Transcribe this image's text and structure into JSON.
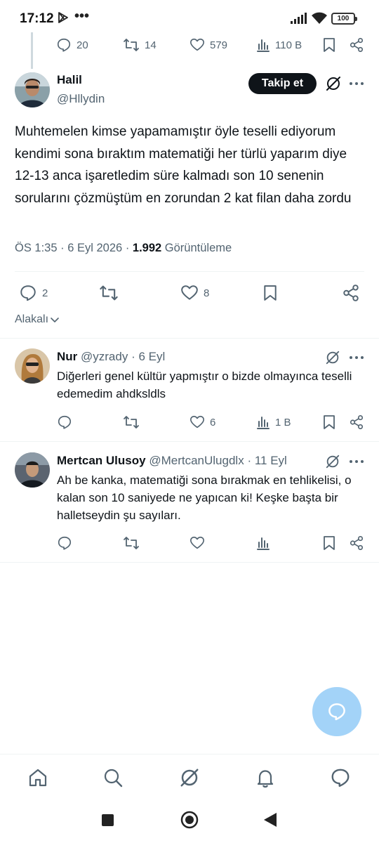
{
  "status_bar": {
    "time": "17:12",
    "dots": "•••",
    "battery": "100"
  },
  "parent_tweet_actions": {
    "replies": "20",
    "retweets": "14",
    "likes": "579",
    "views": "110 B"
  },
  "main_tweet": {
    "author_name": "Halil",
    "author_handle": "@Hllydin",
    "follow_label": "Takip et",
    "text": "Muhtemelen kimse yapamamıştır öyle teselli ediyorum kendimi sona bıraktım matematiği her türlü yaparım diye 12-13 anca işaretledim süre kalmadı son 10 senenin sorularını çözmüştüm en zorundan 2 kat filan daha zordu",
    "time": "ÖS 1:35",
    "sep1": "·",
    "date": "6 Eyl 2026",
    "sep2": "·",
    "views_count": "1.992",
    "views_label": "Görüntüleme",
    "replies": "2",
    "likes": "8"
  },
  "sort_label": "Alakalı",
  "replies": [
    {
      "name": "Nur",
      "handle": "@yzrady",
      "date": "· 6 Eyl",
      "text": "Diğerleri genel kültür yapmıştır o bizde olmayınca teselli edemedim ahdksldls",
      "likes": "6",
      "views": "1 B"
    },
    {
      "name": "Mertcan Ulusoy",
      "handle": "@MertcanUlugdlx",
      "date": "· 11 Eyl",
      "text": "Ah be kanka, matematiği sona bırakmak en tehlikelisi, o kalan son 10 saniyede ne yapıcan ki! Keşke başta bir halletseydin şu sayıları."
    }
  ],
  "colors": {
    "text": "#0f1419",
    "secondary": "#536471",
    "fab": "#a3d3f8",
    "divider": "#eff3f4"
  },
  "icons": [
    "reply-icon",
    "retweet-icon",
    "like-icon",
    "views-icon",
    "bookmark-icon",
    "share-icon",
    "grok-icon",
    "more-icon",
    "home-icon",
    "search-icon",
    "notifications-icon",
    "messages-icon"
  ]
}
